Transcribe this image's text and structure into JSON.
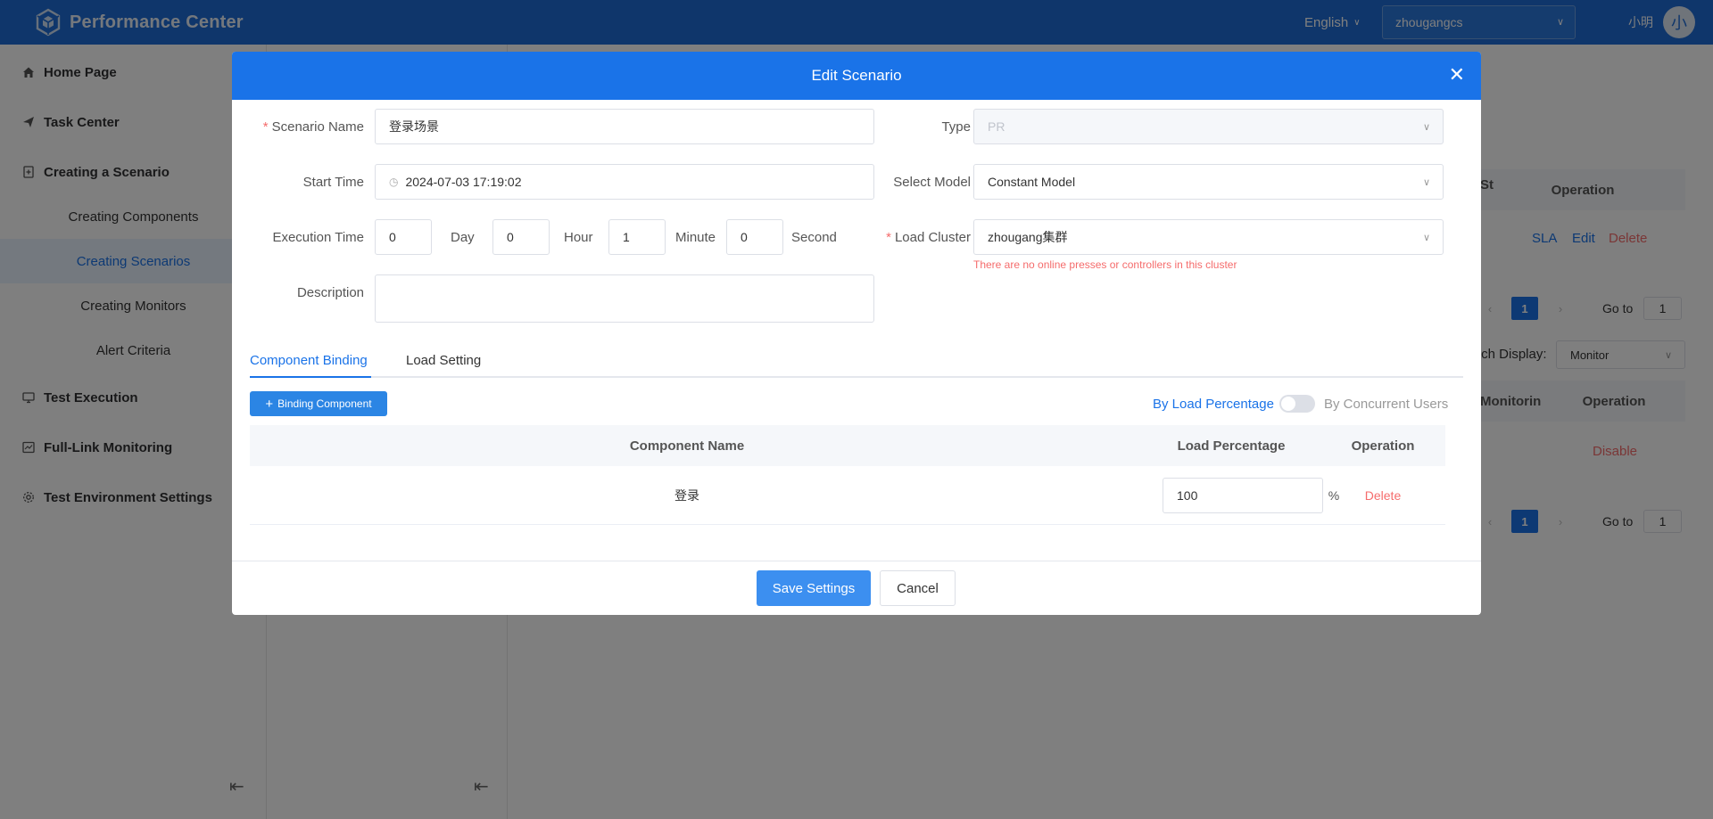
{
  "header": {
    "app_title": "Performance Center",
    "language": "English",
    "project": "zhougangcs",
    "user_name": "小明",
    "avatar_initial": "小",
    "brand_color": "#1f6dd6"
  },
  "sidebar": {
    "items": [
      {
        "label": "Home Page",
        "icon": "home-icon"
      },
      {
        "label": "Task Center",
        "icon": "send-icon"
      },
      {
        "label": "Creating a Scenario",
        "icon": "document-add-icon"
      },
      {
        "label": "Creating Components"
      },
      {
        "label": "Creating Scenarios"
      },
      {
        "label": "Creating Monitors"
      },
      {
        "label": "Alert Criteria"
      },
      {
        "label": "Test Execution",
        "icon": "monitor-icon"
      },
      {
        "label": "Full-Link Monitoring",
        "icon": "monitoring-icon"
      },
      {
        "label": "Test Environment Settings",
        "icon": "gear-icon"
      }
    ]
  },
  "background": {
    "operation_header": "Operation",
    "st_fragment": "St",
    "sla_link": "SLA",
    "edit_link": "Edit",
    "delete_link": "Delete",
    "page_current": "1",
    "goto_label": "Go to",
    "goto_value": "1",
    "batch_display_label": "tch Display:",
    "batch_display_value": "Monitor",
    "monitoring_header": "Monitorin",
    "operation_header2": "Operation",
    "disable_link": "Disable"
  },
  "modal": {
    "title": "Edit Scenario",
    "scenario_name_label": "Scenario Name",
    "scenario_name_value": "登录场景",
    "type_label": "Type",
    "type_value": "PR",
    "start_time_label": "Start Time",
    "start_time_value": "2024-07-03 17:19:02",
    "select_model_label": "Select Model",
    "select_model_value": "Constant Model",
    "execution_time_label": "Execution Time",
    "exec_day_value": "0",
    "day_unit": "Day",
    "exec_hour_value": "0",
    "hour_unit": "Hour",
    "exec_minute_value": "1",
    "minute_unit": "Minute",
    "exec_second_value": "0",
    "second_unit": "Second",
    "load_cluster_label": "Load Cluster",
    "load_cluster_value": "zhougang集群",
    "load_cluster_error": "There are no online presses or controllers in this cluster",
    "description_label": "Description",
    "tabs": [
      {
        "label": "Component Binding"
      },
      {
        "label": "Load Setting"
      }
    ],
    "binding_button": "Binding Component",
    "by_load_percentage": "By Load Percentage",
    "by_concurrent_users": "By Concurrent Users",
    "table": {
      "headers": [
        "Component Name",
        "Load Percentage",
        "Operation"
      ],
      "rows": [
        {
          "component": "登录",
          "load": "100",
          "unit": "%",
          "action": "Delete"
        }
      ]
    },
    "save_button": "Save Settings",
    "cancel_button": "Cancel"
  }
}
